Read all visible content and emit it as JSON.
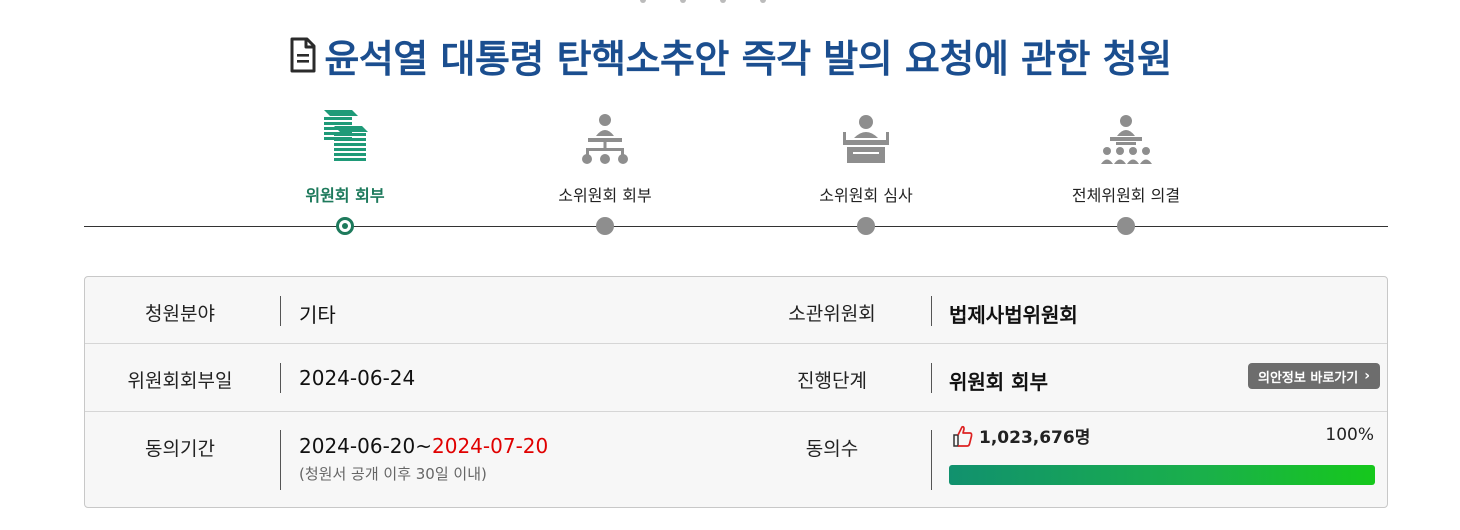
{
  "petition": {
    "title": "윤석열 대통령 탄핵소추안 즉각 발의 요청에 관한 청원"
  },
  "progress": {
    "steps": [
      {
        "label": "위원회 회부",
        "icon": "document-stack-icon",
        "active": true
      },
      {
        "label": "소위원회 회부",
        "icon": "org-chart-icon",
        "active": false
      },
      {
        "label": "소위원회 심사",
        "icon": "podium-speaker-icon",
        "active": false
      },
      {
        "label": "전체위원회 의결",
        "icon": "plenary-meeting-icon",
        "active": false
      }
    ]
  },
  "details": {
    "field_label": "청원분야",
    "field_value": "기타",
    "committee_label": "소관위원회",
    "committee_value": "법제사법위원회",
    "referral_date_label": "위원회회부일",
    "referral_date_value": "2024-06-24",
    "stage_label": "진행단계",
    "stage_value": "위원회 회부",
    "bill_info_button": "의안정보 바로가기",
    "agree_period_label": "동의기간",
    "agree_period_start": "2024-06-20",
    "agree_period_tilde": "~",
    "agree_period_end": "2024-07-20",
    "agree_period_note": "(청원서 공개 이후 30일 이내)",
    "agree_count_label": "동의수",
    "agree_count_value": "1,023,676명",
    "agree_percent": "100%",
    "agree_progress": 1.0
  },
  "colors": {
    "title": "#1b4e8f",
    "active_step": "#1e7a5c",
    "inactive_step": "#8e8e8e",
    "end_date": "#e00000",
    "bar_start": "#11916e",
    "bar_end": "#16c81c"
  }
}
